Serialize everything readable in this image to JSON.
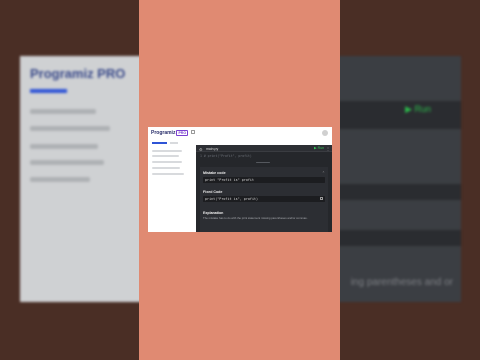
{
  "background": {
    "logo": "Programiz PRO",
    "run_label": "▶ Run",
    "partial_text": "ing parentheses and or"
  },
  "card": {
    "logo_text": "Programiz",
    "logo_badge": "PRO",
    "editor": {
      "file_name": "main.py",
      "run_label": "▶ Run",
      "menu_glyph": "⋮",
      "code_line": "1 # print(\"Profit\", profit)"
    },
    "panel": {
      "mistake_heading": "Mistake code",
      "mistake_code": "print \"Profit is\" profit",
      "fixed_heading": "Fixed Code",
      "fixed_code": "print(\"Profit is\", profit)",
      "explanation_heading": "Explanation",
      "explanation_text": "The mistake has to do with the print statement missing parentheses and/or commas."
    }
  },
  "colors": {
    "outer": "#4a2e25",
    "salmon": "#e08a72",
    "accent": "#2f54d6",
    "run_green": "#39c45a"
  }
}
